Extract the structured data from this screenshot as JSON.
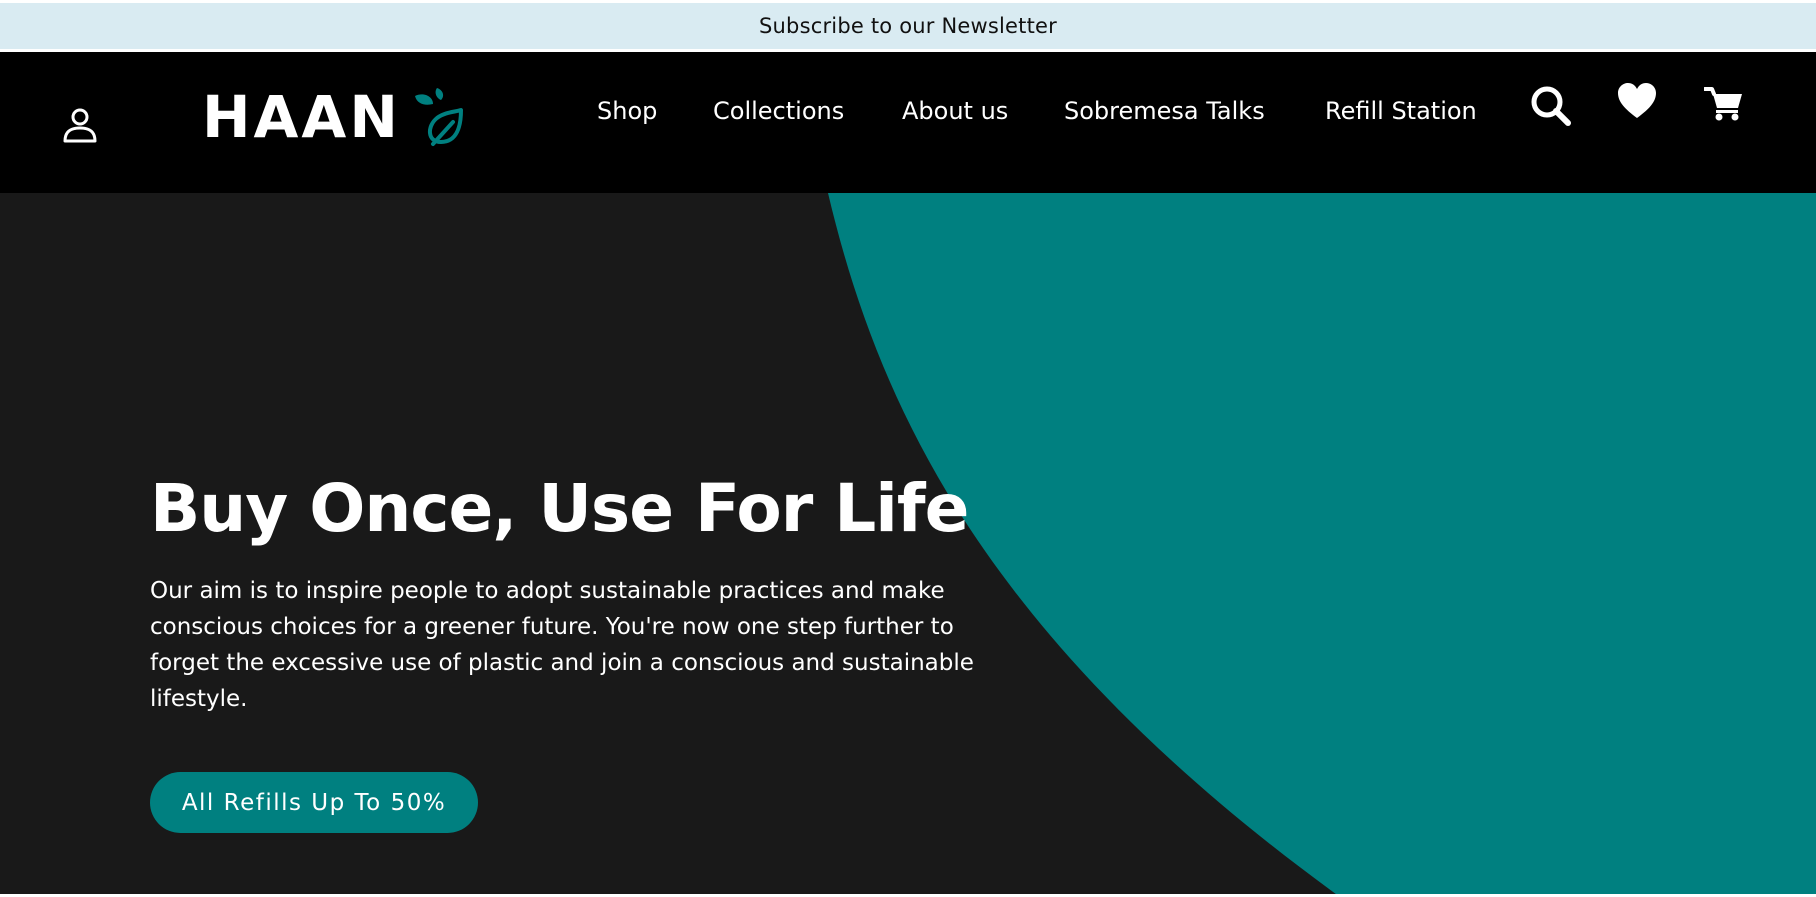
{
  "announcement": {
    "text": "Subscribe to our Newsletter"
  },
  "header": {
    "logo_text": "HAAN",
    "nav": [
      {
        "label": "Shop"
      },
      {
        "label": "Collections"
      },
      {
        "label": "About us"
      },
      {
        "label": "Sobremesa Talks"
      },
      {
        "label": "Refill Station"
      }
    ],
    "icons": [
      "user-icon",
      "search-icon",
      "heart-icon",
      "cart-icon"
    ]
  },
  "hero": {
    "title": "Buy Once, Use For Life",
    "description": "Our aim is to inspire people to adopt sustainable practices and make conscious choices for a greener future. You're now one step further to forget the excessive use of plastic and join a conscious and sustainable lifestyle.",
    "cta_label": "All Refills Up To 50%"
  },
  "colors": {
    "announcement_bg": "#d9ebf2",
    "nav_bg": "#000000",
    "hero_bg": "#191919",
    "accent_teal": "#008080",
    "text_light": "#ffffff"
  }
}
